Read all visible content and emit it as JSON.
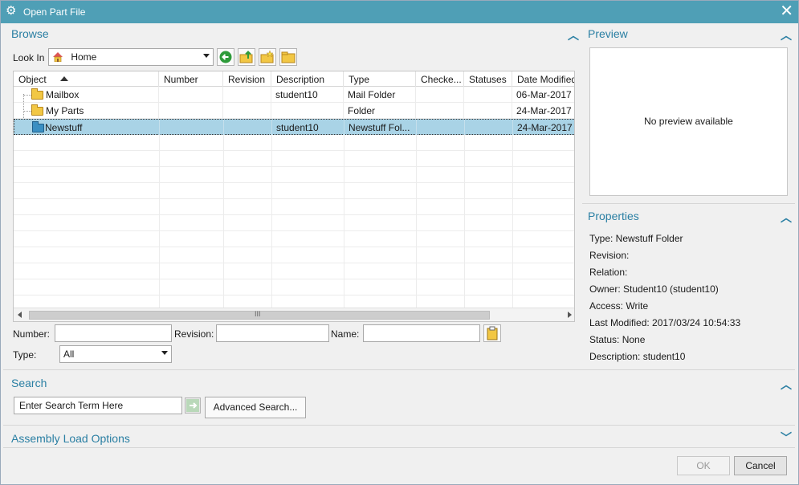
{
  "window": {
    "title": "Open Part File"
  },
  "browse": {
    "heading": "Browse",
    "look_in_label": "Look In",
    "look_in_value": "Home",
    "columns": [
      "Object",
      "Number",
      "Revision",
      "Description",
      "Type",
      "Checke...",
      "Statuses",
      "Date Modified"
    ],
    "rows": [
      {
        "object": "Mailbox",
        "number": "",
        "revision": "",
        "description": "student10",
        "type": "Mail Folder",
        "checked": "",
        "statuses": "",
        "date": "06-Mar-2017 ..."
      },
      {
        "object": "My Parts",
        "number": "",
        "revision": "",
        "description": "",
        "type": "Folder",
        "checked": "",
        "statuses": "",
        "date": "24-Mar-2017 ..."
      },
      {
        "object": "Newstuff",
        "number": "",
        "revision": "",
        "description": "student10",
        "type": "Newstuff Fol...",
        "checked": "",
        "statuses": "",
        "date": "24-Mar-2017 ..."
      }
    ],
    "number_label": "Number:",
    "revision_label": "Revision:",
    "name_label": "Name:",
    "type_label": "Type:",
    "type_value": "All",
    "scroll_grip": "III"
  },
  "preview": {
    "heading": "Preview",
    "empty_text": "No preview available"
  },
  "properties": {
    "heading": "Properties",
    "items": [
      "Type: Newstuff Folder",
      "Revision:",
      "Relation:",
      "Owner: Student10 (student10)",
      "Access: Write",
      "Last Modified: 2017/03/24 10:54:33",
      "Status: None",
      "Description: student10"
    ]
  },
  "search": {
    "heading": "Search",
    "input_value": "Enter Search Term Here",
    "advanced_label": "Advanced Search..."
  },
  "assembly": {
    "heading": "Assembly Load Options"
  },
  "footer": {
    "ok_label": "OK",
    "cancel_label": "Cancel"
  },
  "colors": {
    "titlebar": "#4f9fb6",
    "accent": "#2a7fa3",
    "selection": "#a9d3e6"
  }
}
